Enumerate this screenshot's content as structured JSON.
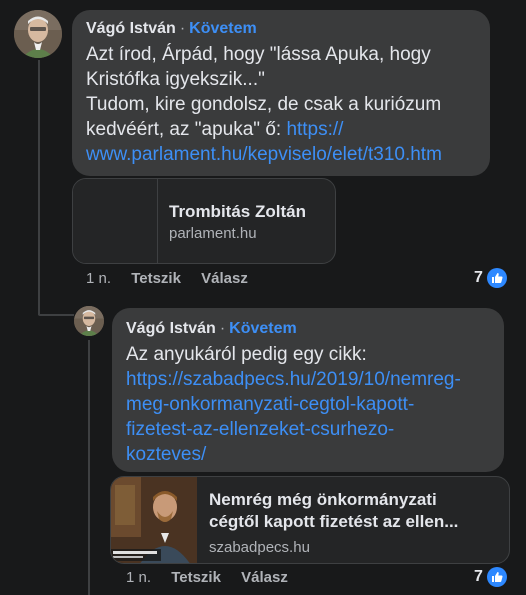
{
  "comment1": {
    "author": "Vágó István",
    "separator": "·",
    "follow_label": "Követem",
    "text_lines": [
      "Azt írod, Árpád, hogy \"lássa Apuka, hogy",
      "Kristófka igyekszik...\"",
      "Tudom, kire gondolsz, de csak a kuriózum",
      "kedvéért, az \"apuka\" ő: "
    ],
    "link_part1": "https://",
    "link_part2": "www.parlament.hu/kepviselo/elet/t310.htm",
    "card": {
      "title": "Trombitás Zoltán",
      "domain": "parlament.hu"
    },
    "time": "1 n.",
    "like_label": "Tetszik",
    "reply_label": "Válasz",
    "reaction_count": "7",
    "reaction_icon": "thumbs-up-icon"
  },
  "comment2": {
    "author": "Vágó István",
    "separator": "·",
    "follow_label": "Követem",
    "text": "Az anyukáról pedig egy cikk:",
    "link_lines": [
      "https://szabadpecs.hu/2019/10/nemreg-",
      "meg-onkormanyzati-cegtol-kapott-",
      "fizetest-az-ellenzeket-csurhezo-",
      "kozteves/"
    ],
    "card": {
      "title_line1": "Nemrég még önkormányzati",
      "title_line2": "cégtől kapott fizetést az ellen...",
      "domain": "szabadpecs.hu"
    },
    "time": "1 n.",
    "like_label": "Tetszik",
    "reply_label": "Válasz",
    "reaction_count": "7",
    "reaction_icon": "thumbs-up-icon"
  },
  "colors": {
    "background": "#18191a",
    "bubble": "#3a3b3c",
    "link": "#3d8ff6",
    "like": "#2d88ff"
  }
}
